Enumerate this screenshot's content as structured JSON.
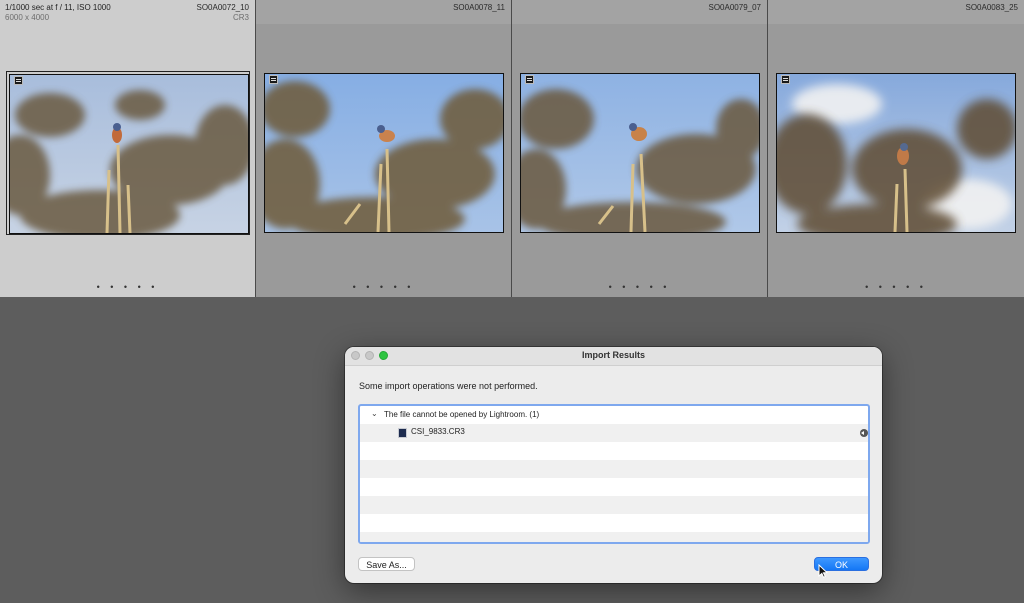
{
  "grid": {
    "cells": [
      {
        "exposure": "1/1000 sec at f / 11, ISO 1000",
        "dimensions": "6000 x 4000",
        "filename": "SO0A0072_10",
        "extension": "CR3",
        "dots": "• • • • •",
        "selected": true
      },
      {
        "exposure": "",
        "dimensions": "",
        "filename": "SO0A0078_11",
        "extension": "",
        "dots": "• • • • •",
        "selected": false
      },
      {
        "exposure": "",
        "dimensions": "",
        "filename": "SO0A0079_07",
        "extension": "",
        "dots": "• • • • •",
        "selected": false
      },
      {
        "exposure": "",
        "dimensions": "",
        "filename": "SO0A0083_25",
        "extension": "",
        "dots": "• • • • •",
        "selected": false
      }
    ]
  },
  "dialog": {
    "title": "Import Results",
    "message": "Some import operations were not performed.",
    "group_label": "The file cannot be opened by Lightroom. (1)",
    "file_name": "CSI_9833.CR3",
    "save_button": "Save As...",
    "ok_button": "OK"
  },
  "colors": {
    "accent": "#1477f5",
    "list_focus_ring": "#7ea8ee",
    "window_background": "#5d5d5d"
  },
  "icons": [
    "expand-icon",
    "file-cr3-icon",
    "row-arrow-icon",
    "stack-badge-icon",
    "cursor-arrow-icon"
  ]
}
